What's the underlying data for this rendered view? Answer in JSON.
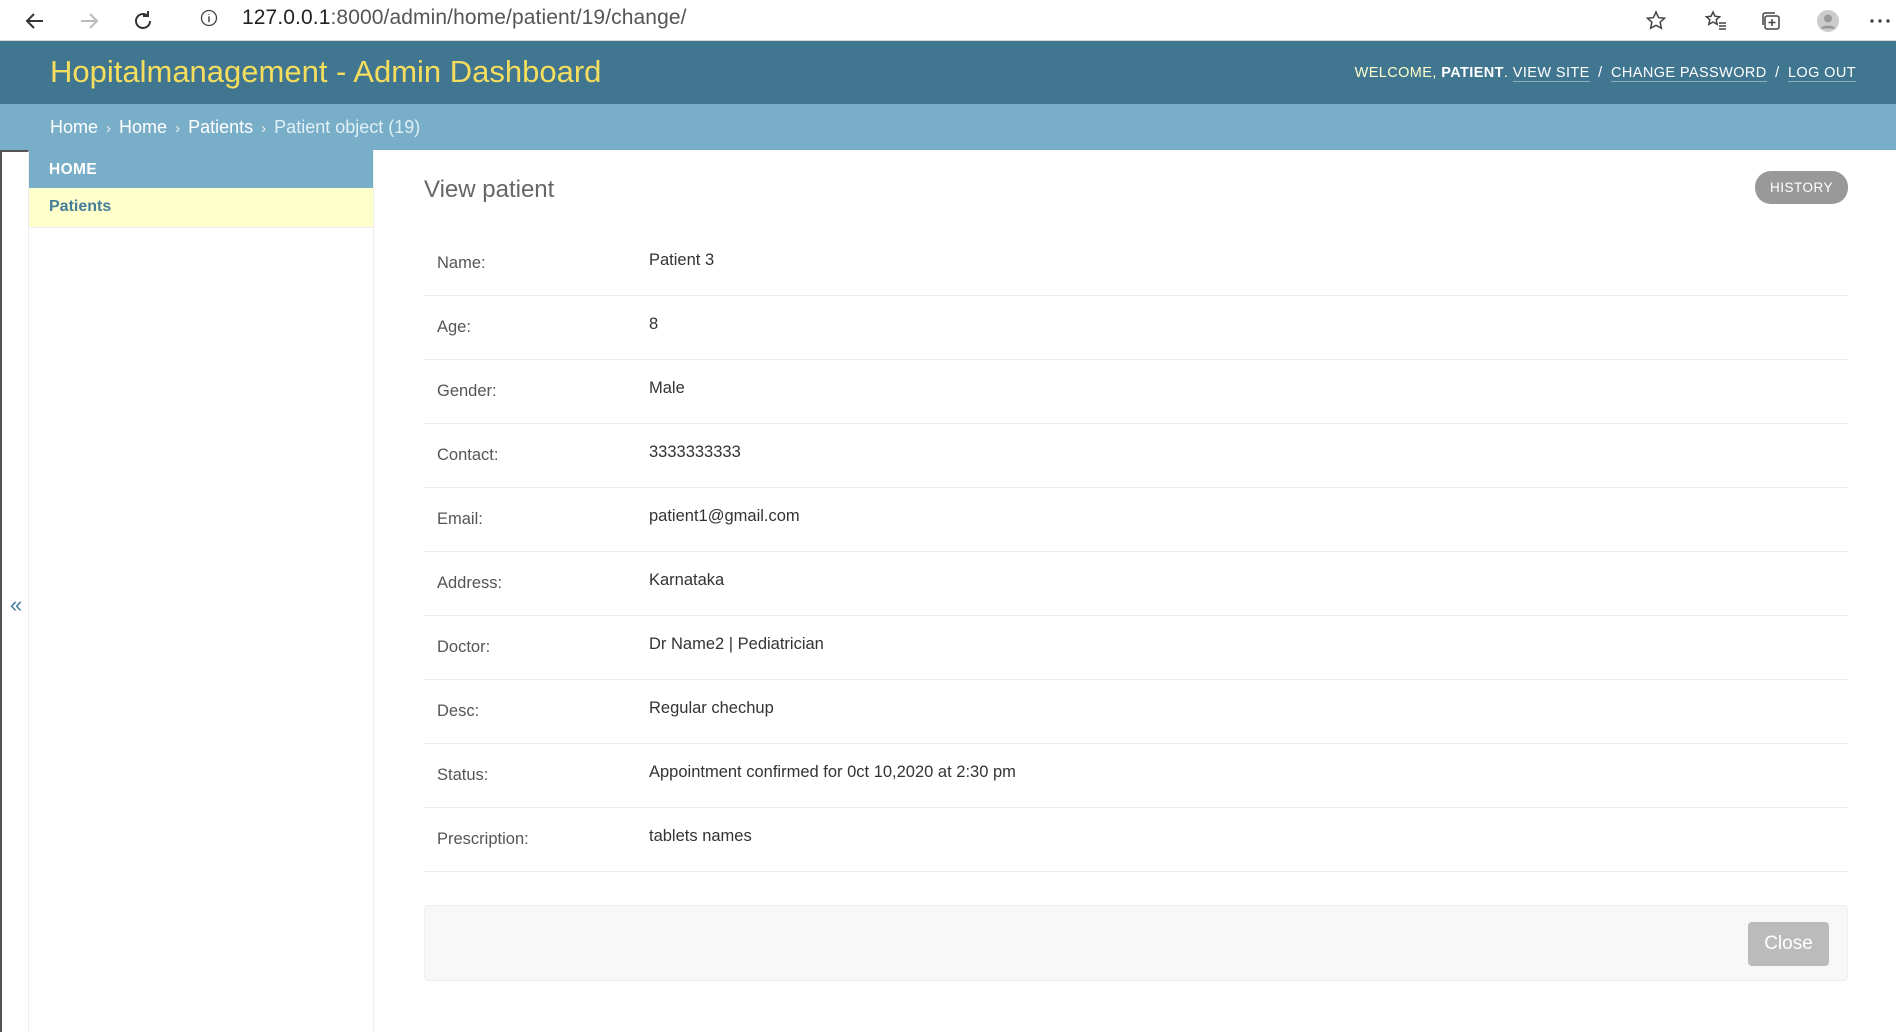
{
  "browser": {
    "url_host": "127.0.0.1",
    "url_rest": ":8000/admin/home/patient/19/change/"
  },
  "header": {
    "site_title": "Hopitalmanagement - Admin Dashboard",
    "welcome": "Welcome,",
    "username": "Patient",
    "view_site": "View site",
    "change_password": "Change password",
    "log_out": "Log out",
    "sep": "/"
  },
  "breadcrumbs": {
    "items": [
      "Home",
      "Home",
      "Patients"
    ],
    "current": "Patient object (19)",
    "arrow": "›"
  },
  "sidebar": {
    "toggle": "«",
    "module_caption": "Home",
    "items": [
      {
        "label": "Patients"
      }
    ]
  },
  "content": {
    "title": "View patient",
    "history_label": "History",
    "fields": [
      {
        "label": "Name:",
        "value": "Patient 3"
      },
      {
        "label": "Age:",
        "value": "8"
      },
      {
        "label": "Gender:",
        "value": "Male"
      },
      {
        "label": "Contact:",
        "value": "3333333333"
      },
      {
        "label": "Email:",
        "value": "patient1@gmail.com"
      },
      {
        "label": "Address:",
        "value": "Karnataka"
      },
      {
        "label": "Doctor:",
        "value": "Dr Name2 | Pediatrician"
      },
      {
        "label": "Desc:",
        "value": "Regular chechup"
      },
      {
        "label": "Status:",
        "value": "Appointment confirmed for 0ct 10,2020 at 2:30 pm"
      },
      {
        "label": "Prescription:",
        "value": "tablets names"
      }
    ],
    "close_label": "Close"
  },
  "colors": {
    "header_bg": "#417690",
    "breadcrumb_bg": "#79aec8",
    "title_yellow": "#f5dd5d",
    "sidebar_highlight": "#ffffcc",
    "link_blue": "#447e9b"
  },
  "icons": [
    "back-arrow-icon",
    "forward-arrow-icon",
    "refresh-icon",
    "info-icon",
    "star-icon",
    "favorites-icon",
    "collections-icon",
    "profile-icon",
    "more-icon"
  ]
}
